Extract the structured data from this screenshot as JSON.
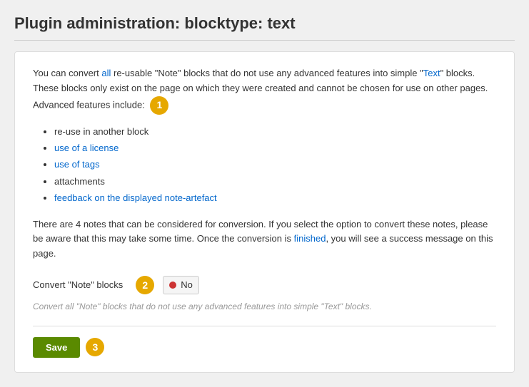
{
  "page": {
    "title": "Plugin administration: blocktype: text"
  },
  "card": {
    "description_1": "You can convert all re-usable \"Note\" blocks that do not use any advanced features into simple \"Text\" blocks. These blocks only exist on the page on which they were created and cannot be chosen for use on other pages. Advanced features include:",
    "features": [
      {
        "label": "re-use in another block",
        "is_link": false
      },
      {
        "label": "use of a license",
        "is_link": false
      },
      {
        "label": "use of tags",
        "is_link": false
      },
      {
        "label": "attachments",
        "is_link": false
      },
      {
        "label": "feedback on the displayed note-artefact",
        "is_link": false
      }
    ],
    "notes_info": "There are 4 notes that can be considered for conversion. If you select the option to convert these notes, please be aware that this may take some time. Once the conversion is finished, you will see a success message on this page.",
    "form": {
      "label": "Convert \"Note\" blocks",
      "toggle_value": "No",
      "help_text": "Convert all \"Note\" blocks that do not use any advanced features into simple \"Text\" blocks."
    },
    "save_button": "Save"
  },
  "badges": {
    "one": "1",
    "two": "2",
    "three": "3"
  }
}
